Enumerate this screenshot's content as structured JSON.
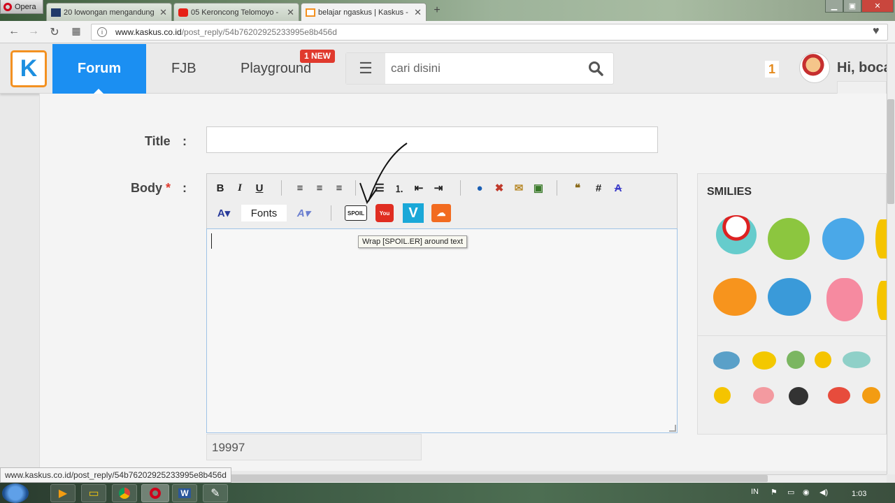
{
  "browser": {
    "opera_label": "Opera",
    "tabs": [
      {
        "title": "20 lowongan mengandung",
        "close": "✕"
      },
      {
        "title": "05 Keroncong Telomoyo -",
        "close": "✕"
      },
      {
        "title": "belajar ngaskus | Kaskus -",
        "close": "✕"
      }
    ],
    "new_tab": "+",
    "url_host": "www.kaskus.co.id",
    "url_path": "/post_reply/54b76202925233995e8b456d",
    "status_url": "www.kaskus.co.id/post_reply/54b76202925233995e8b456d"
  },
  "header": {
    "logo": "K",
    "nav": {
      "forum": "Forum",
      "fjb": "FJB",
      "playground": "Playground"
    },
    "new_badge": "1 NEW",
    "search_placeholder": "cari disini",
    "notification_count": "1",
    "greeting": "Hi, boca"
  },
  "form": {
    "title_label": "Title",
    "title_colon": ":",
    "body_label": "Body",
    "required_mark": "*",
    "body_colon": ":",
    "fonts_button": "Fonts",
    "tooltip": "Wrap [SPOIL.ER] around text",
    "char_counter": "19997"
  },
  "smilies": {
    "title": "SMILIES"
  },
  "taskbar": {
    "lang": "IN",
    "clock": "1:03"
  },
  "colors": {
    "accent": "#1b8ff2",
    "logo_border": "#f39121",
    "badge": "#e03a2e"
  }
}
